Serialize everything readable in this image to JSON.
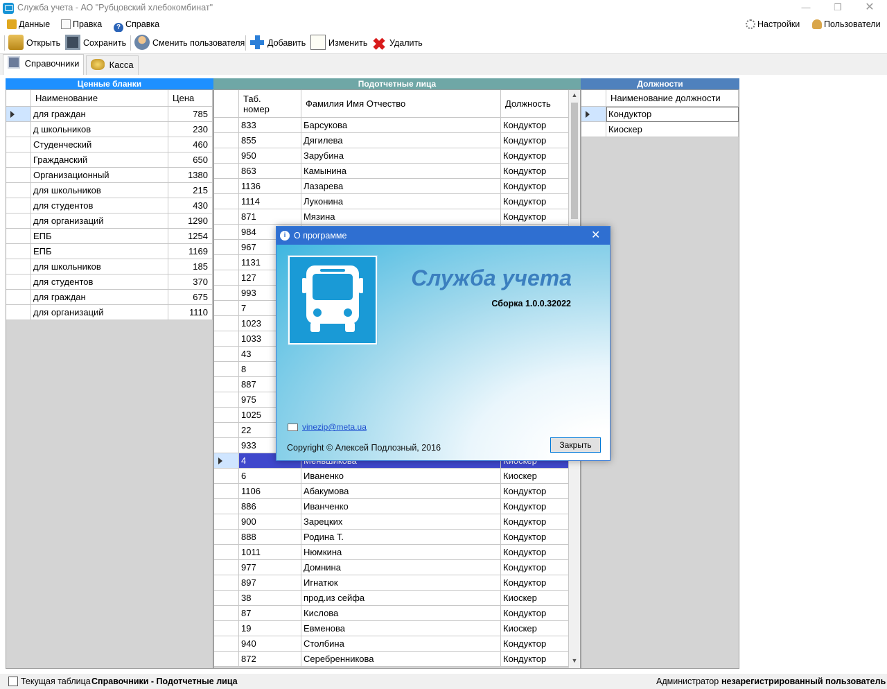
{
  "window": {
    "title": "Служба учета - АО \"Рубцовский хлебокомбинат\""
  },
  "menu": {
    "data": "Данные",
    "edit": "Правка",
    "help": "Справка",
    "settings": "Настройки",
    "users": "Пользователи"
  },
  "toolbar": {
    "open": "Открыть",
    "save": "Сохранить",
    "switch_user": "Сменить пользователя",
    "add": "Добавить",
    "edit": "Изменить",
    "delete": "Удалить"
  },
  "tabs": {
    "reference": "Справочники",
    "cash": "Касса"
  },
  "colors": {
    "panel_blue": "#1e90ff",
    "panel_teal": "#6fa7a6",
    "panel_steel": "#4f81bd",
    "selection": "#3f48cc",
    "dialog_title": "#2f6fd1"
  },
  "blanks": {
    "title": "Ценные бланки",
    "col_name": "Наименование",
    "col_price": "Цена",
    "rows": [
      {
        "name": "для граждан",
        "price": "785"
      },
      {
        "name": "д школьников",
        "price": "230"
      },
      {
        "name": "Студенческий",
        "price": "460"
      },
      {
        "name": "Гражданский",
        "price": "650"
      },
      {
        "name": "Организационный",
        "price": "1380"
      },
      {
        "name": "для школьников",
        "price": "215"
      },
      {
        "name": "для студентов",
        "price": "430"
      },
      {
        "name": "для организаций",
        "price": "1290"
      },
      {
        "name": "ЕПБ",
        "price": "1254"
      },
      {
        "name": "ЕПБ",
        "price": "1169"
      },
      {
        "name": "для школьников",
        "price": "185"
      },
      {
        "name": "для студентов",
        "price": "370"
      },
      {
        "name": "для граждан",
        "price": "675"
      },
      {
        "name": "для организаций",
        "price": "1110"
      }
    ]
  },
  "persons": {
    "title": "Подотчетные лица",
    "col_num_1": "Таб.",
    "col_num_2": "номер",
    "col_name": "Фамилия Имя Отчество",
    "col_position": "Должность",
    "rows": [
      {
        "num": "833",
        "name": "Барсукова",
        "pos": "Кондуктор"
      },
      {
        "num": "855",
        "name": "Дягилева",
        "pos": "Кондуктор"
      },
      {
        "num": "950",
        "name": "Зарубина",
        "pos": "Кондуктор"
      },
      {
        "num": "863",
        "name": "Камынина",
        "pos": "Кондуктор"
      },
      {
        "num": "1136",
        "name": "Лазарева",
        "pos": "Кондуктор"
      },
      {
        "num": "1114",
        "name": "Луконина",
        "pos": "Кондуктор"
      },
      {
        "num": "871",
        "name": "Мязина",
        "pos": "Кондуктор"
      },
      {
        "num": "984",
        "name": "",
        "pos": ""
      },
      {
        "num": "967",
        "name": "",
        "pos": ""
      },
      {
        "num": "1131",
        "name": "",
        "pos": ""
      },
      {
        "num": "127",
        "name": "",
        "pos": ""
      },
      {
        "num": "993",
        "name": "",
        "pos": ""
      },
      {
        "num": "7",
        "name": "",
        "pos": ""
      },
      {
        "num": "1023",
        "name": "",
        "pos": ""
      },
      {
        "num": "1033",
        "name": "",
        "pos": ""
      },
      {
        "num": "43",
        "name": "",
        "pos": ""
      },
      {
        "num": "8",
        "name": "",
        "pos": ""
      },
      {
        "num": "887",
        "name": "",
        "pos": ""
      },
      {
        "num": "975",
        "name": "",
        "pos": ""
      },
      {
        "num": "1025",
        "name": "",
        "pos": ""
      },
      {
        "num": "22",
        "name": "",
        "pos": ""
      },
      {
        "num": "933",
        "name": "",
        "pos": ""
      },
      {
        "num": "4",
        "name": "Меньшикова",
        "pos": "Киоскер"
      },
      {
        "num": "6",
        "name": "Иваненко",
        "pos": "Киоскер"
      },
      {
        "num": "1106",
        "name": "Абакумова",
        "pos": "Кондуктор"
      },
      {
        "num": "886",
        "name": "Иванченко",
        "pos": "Кондуктор"
      },
      {
        "num": "900",
        "name": "Зарецких",
        "pos": "Кондуктор"
      },
      {
        "num": "888",
        "name": "Родина Т.",
        "pos": "Кондуктор"
      },
      {
        "num": "1011",
        "name": "Нюмкина",
        "pos": "Кондуктор"
      },
      {
        "num": "977",
        "name": "Домнина",
        "pos": "Кондуктор"
      },
      {
        "num": "897",
        "name": "Игнатюк",
        "pos": "Кондуктор"
      },
      {
        "num": "38",
        "name": "прод.из сейфа",
        "pos": "Киоскер"
      },
      {
        "num": "87",
        "name": "Кислова",
        "pos": "Кондуктор"
      },
      {
        "num": "19",
        "name": "Евменова",
        "pos": "Киоскер"
      },
      {
        "num": "940",
        "name": "Столбина",
        "pos": "Кондуктор"
      },
      {
        "num": "872",
        "name": "Серебренникова",
        "pos": "Кондуктор"
      }
    ]
  },
  "positions": {
    "title": "Должности",
    "col_name": "Наименование должности",
    "rows": [
      {
        "name": "Кондуктор"
      },
      {
        "name": "Киоскер"
      }
    ]
  },
  "status": {
    "current_table_label": "Текущая таблица",
    "current_table_value": "Справочники - Подотчетные лица",
    "user_role": "Администратор",
    "user_state": "незарегистрированный пользователь"
  },
  "dialog": {
    "title": "О программе",
    "app_name": "Служба учета",
    "build": "Сборка 1.0.0.32022",
    "email": "vinezip@meta.ua",
    "copyright": "Copyright © Алексей Подлозный, 2016",
    "close_button": "Закрыть"
  }
}
